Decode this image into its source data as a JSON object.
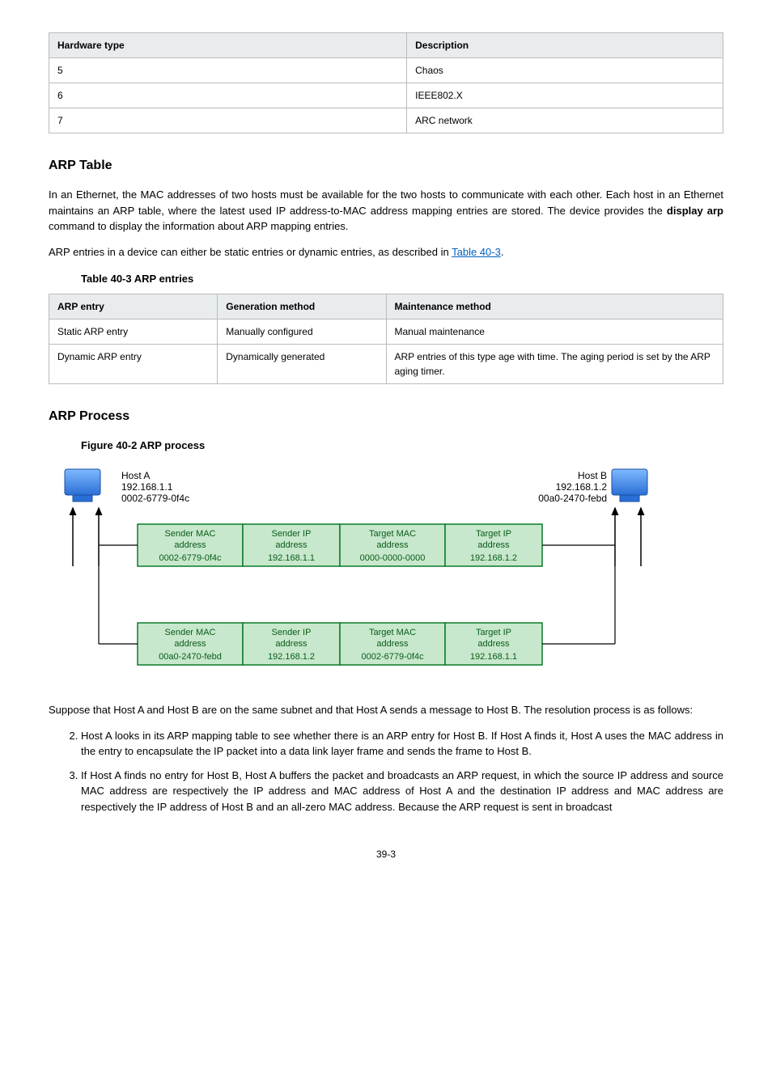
{
  "table1": {
    "headers": [
      "Hardware type",
      "Description"
    ],
    "rows": [
      [
        "5",
        "Chaos"
      ],
      [
        "6",
        "IEEE802.X"
      ],
      [
        "7",
        "ARC network"
      ]
    ]
  },
  "heading_arp_table": "ARP Table",
  "para1_a": "In an Ethernet, the MAC addresses of two hosts must be available for the two hosts to communicate with each other. Each host in an Ethernet maintains an ARP table, where the latest used IP address-to-MAC address mapping entries are stored. The device provides the ",
  "para1_cmd": "display arp",
  "para1_b": " command to display the information about ARP mapping entries.",
  "para2_a": "ARP entries in a device can either be static entries or dynamic entries, as described in ",
  "para2_link": "Table 40-3",
  "para2_b": ".",
  "caption_table": "Table 40-3 ARP entries",
  "table2": {
    "headers": [
      "ARP entry",
      "Generation method",
      "Maintenance method"
    ],
    "rows": [
      [
        "Static ARP entry",
        "Manually configured",
        "Manual maintenance"
      ],
      [
        "Dynamic ARP entry",
        "Dynamically generated",
        "ARP entries of this type age with time. The aging period is set by the ARP aging timer."
      ]
    ]
  },
  "heading_arp_process": "ARP Process",
  "caption_figure": "Figure 40-2 ARP process",
  "figure": {
    "hostA": {
      "name": "Host A",
      "ip": "192.168.1.1",
      "mac": "0002-6779-0f4c"
    },
    "hostB": {
      "name": "Host B",
      "ip": "192.168.1.2",
      "mac": "00a0-2470-febd"
    },
    "row1": {
      "c1": {
        "l1": "Sender MAC",
        "l2": "address",
        "l3": "0002-6779-0f4c"
      },
      "c2": {
        "l1": "Sender IP",
        "l2": "address",
        "l3": "192.168.1.1"
      },
      "c3": {
        "l1": "Target MAC",
        "l2": "address",
        "l3": "0000-0000-0000"
      },
      "c4": {
        "l1": "Target IP",
        "l2": "address",
        "l3": "192.168.1.2"
      }
    },
    "row2": {
      "c1": {
        "l1": "Sender MAC",
        "l2": "address",
        "l3": "00a0-2470-febd"
      },
      "c2": {
        "l1": "Sender IP",
        "l2": "address",
        "l3": "192.168.1.2"
      },
      "c3": {
        "l1": "Target MAC",
        "l2": "address",
        "l3": "0002-6779-0f4c"
      },
      "c4": {
        "l1": "Target IP",
        "l2": "address",
        "l3": "192.168.1.1"
      }
    }
  },
  "para3": "Suppose that Host A and Host B are on the same subnet and that Host A sends a message to Host B. The resolution process is as follows:",
  "step2": "Host A looks in its ARP mapping table to see whether there is an ARP entry for Host B. If Host A finds it, Host A uses the MAC address in the entry to encapsulate the IP packet into a data link layer frame and sends the frame to Host B.",
  "step3": "If Host A finds no entry for Host B, Host A buffers the packet and broadcasts an ARP request, in which the source IP address and source MAC address are respectively the IP address and MAC address of Host A and the destination IP address and MAC address are respectively the IP address of Host B and an all-zero MAC address. Because the ARP request is sent in broadcast",
  "page_num": "39-3"
}
